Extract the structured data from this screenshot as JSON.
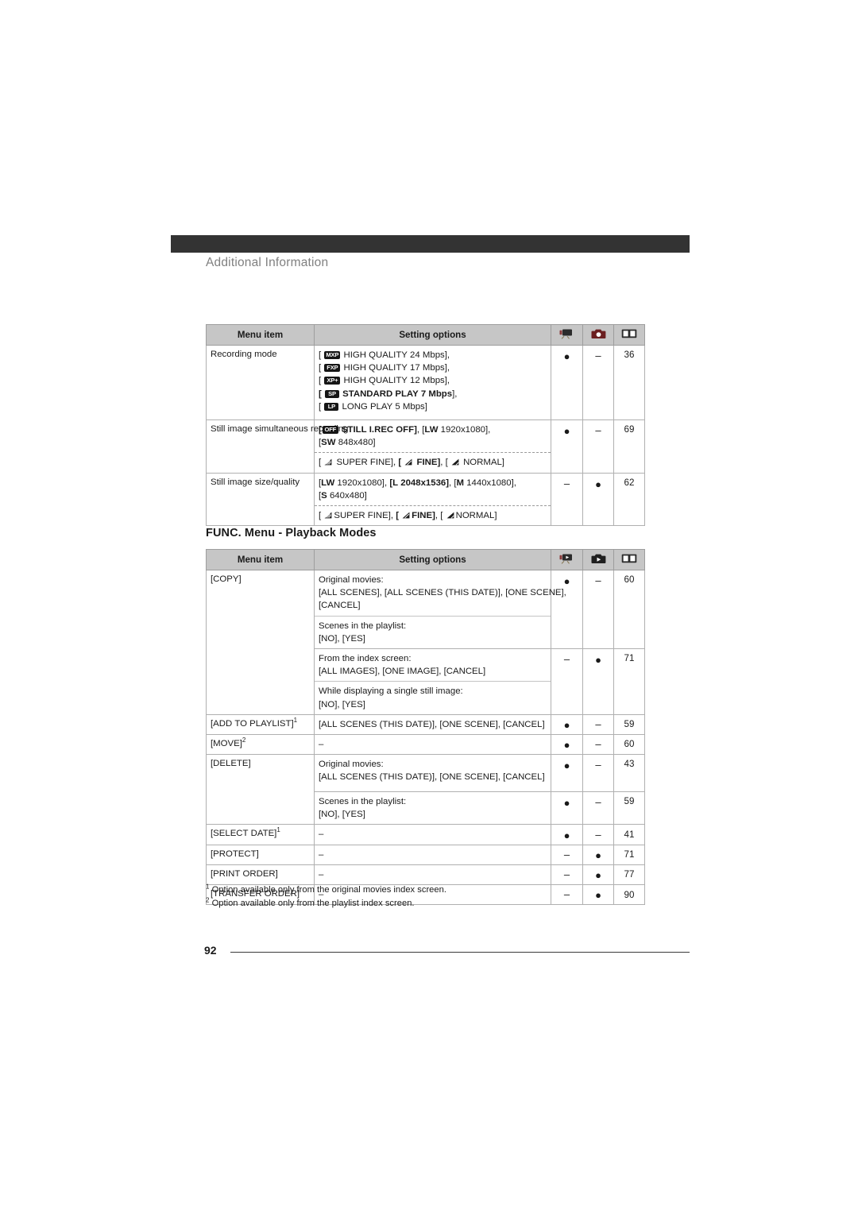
{
  "document": {
    "header_title": "Additional Information",
    "page_number": "92",
    "section_heading": "FUNC. Menu - Playback Modes"
  },
  "columns": {
    "menu_item": "Menu item",
    "setting_options": "Setting options",
    "icon_movie": "camcorder-icon",
    "icon_photo": "camera-icon",
    "icon_page": "open-book-icon",
    "icon_movie_playback": "camcorder-playback-icon",
    "icon_photo_playback": "camera-playback-icon"
  },
  "symbols": {
    "available": "●",
    "not_available": "–"
  },
  "table_recording": {
    "rows": [
      {
        "item": "Recording mode",
        "blocks": [
          {
            "lines": [
              {
                "parts": [
                  {
                    "t": "text",
                    "v": "[ "
                  },
                  {
                    "t": "badge",
                    "v": "MXP"
                  },
                  {
                    "t": "text",
                    "v": " HIGH QUALITY 24 Mbps],"
                  }
                ]
              },
              {
                "parts": [
                  {
                    "t": "text",
                    "v": "[ "
                  },
                  {
                    "t": "badge",
                    "v": "FXP"
                  },
                  {
                    "t": "text",
                    "v": " HIGH QUALITY 17 Mbps],"
                  }
                ]
              },
              {
                "parts": [
                  {
                    "t": "text",
                    "v": "[ "
                  },
                  {
                    "t": "badge",
                    "v": "XP+"
                  },
                  {
                    "t": "text",
                    "v": " HIGH QUALITY 12 Mbps],"
                  }
                ]
              },
              {
                "parts": [
                  {
                    "t": "textb",
                    "v": "[ "
                  },
                  {
                    "t": "badge",
                    "v": "SP"
                  },
                  {
                    "t": "textb",
                    "v": " STANDARD PLAY 7 Mbps"
                  },
                  {
                    "t": "text",
                    "v": "],"
                  }
                ]
              },
              {
                "parts": [
                  {
                    "t": "text",
                    "v": "[ "
                  },
                  {
                    "t": "badge",
                    "v": "LP"
                  },
                  {
                    "t": "text",
                    "v": " LONG PLAY 5 Mbps]"
                  }
                ]
              }
            ]
          }
        ],
        "movie": "●",
        "photo": "–",
        "page": "36"
      },
      {
        "item": "Still image simultaneous recording",
        "blocks": [
          {
            "lines": [
              {
                "parts": [
                  {
                    "t": "textb",
                    "v": "["
                  },
                  {
                    "t": "badge",
                    "v": "OFF"
                  },
                  {
                    "t": "textb",
                    "v": " STILL I.REC OFF]"
                  },
                  {
                    "t": "text",
                    "v": ", ["
                  },
                  {
                    "t": "textb",
                    "v": "LW"
                  },
                  {
                    "t": "text",
                    "v": " 1920x1080],"
                  }
                ]
              },
              {
                "parts": [
                  {
                    "t": "text",
                    "v": "["
                  },
                  {
                    "t": "textb",
                    "v": "SW"
                  },
                  {
                    "t": "text",
                    "v": " 848x480]"
                  }
                ]
              }
            ]
          },
          {
            "dashed": true,
            "lines": [
              {
                "parts": [
                  {
                    "t": "text",
                    "v": "[ "
                  },
                  {
                    "t": "qico",
                    "v": "superfine"
                  },
                  {
                    "t": "text",
                    "v": " SUPER FINE], "
                  },
                  {
                    "t": "textb",
                    "v": "[ "
                  },
                  {
                    "t": "qico",
                    "v": "fine"
                  },
                  {
                    "t": "textb",
                    "v": " FINE]"
                  },
                  {
                    "t": "text",
                    "v": ", [ "
                  },
                  {
                    "t": "qico",
                    "v": "normal"
                  },
                  {
                    "t": "text",
                    "v": " NORMAL]"
                  }
                ]
              }
            ]
          }
        ],
        "movie": "●",
        "photo": "–",
        "page": "69"
      },
      {
        "item": "Still image size/quality",
        "blocks": [
          {
            "lines": [
              {
                "parts": [
                  {
                    "t": "text",
                    "v": "["
                  },
                  {
                    "t": "textb",
                    "v": "LW"
                  },
                  {
                    "t": "text",
                    "v": " 1920x1080], "
                  },
                  {
                    "t": "textb",
                    "v": "[L 2048x1536]"
                  },
                  {
                    "t": "text",
                    "v": ", ["
                  },
                  {
                    "t": "textb",
                    "v": "M"
                  },
                  {
                    "t": "text",
                    "v": " 1440x1080],"
                  }
                ]
              },
              {
                "parts": [
                  {
                    "t": "text",
                    "v": "["
                  },
                  {
                    "t": "textb",
                    "v": "S"
                  },
                  {
                    "t": "text",
                    "v": " 640x480]"
                  }
                ]
              }
            ]
          },
          {
            "dashed": true,
            "lines": [
              {
                "parts": [
                  {
                    "t": "text",
                    "v": "[ "
                  },
                  {
                    "t": "qico",
                    "v": "superfine"
                  },
                  {
                    "t": "text",
                    "v": "SUPER FINE], "
                  },
                  {
                    "t": "textb",
                    "v": "[ "
                  },
                  {
                    "t": "qico",
                    "v": "fine"
                  },
                  {
                    "t": "textb",
                    "v": "FINE]"
                  },
                  {
                    "t": "text",
                    "v": ", [ "
                  },
                  {
                    "t": "qico",
                    "v": "normal"
                  },
                  {
                    "t": "text",
                    "v": "NORMAL]"
                  }
                ]
              }
            ]
          }
        ],
        "movie": "–",
        "photo": "●",
        "page": "62"
      }
    ]
  },
  "table_playback": {
    "rows": [
      {
        "item": "[COPY]",
        "blocks": [
          {
            "lines": [
              {
                "parts": [
                  {
                    "t": "text",
                    "v": "Original movies:"
                  }
                ]
              },
              {
                "parts": [
                  {
                    "t": "text",
                    "v": "[ALL SCENES], [ALL SCENES (THIS DATE)], [ONE SCENE],"
                  }
                ]
              },
              {
                "parts": [
                  {
                    "t": "text",
                    "v": "[CANCEL]"
                  }
                ]
              }
            ]
          },
          {
            "solid": true,
            "lines": [
              {
                "parts": [
                  {
                    "t": "text",
                    "v": "Scenes in the playlist:"
                  }
                ]
              },
              {
                "parts": [
                  {
                    "t": "text",
                    "v": "[NO], [YES]"
                  }
                ]
              }
            ]
          }
        ],
        "movie": "●",
        "photo": "–",
        "page": "60"
      },
      {
        "item": "",
        "blocks": [
          {
            "lines": [
              {
                "parts": [
                  {
                    "t": "text",
                    "v": "From the index screen:"
                  }
                ]
              },
              {
                "parts": [
                  {
                    "t": "text",
                    "v": "[ALL IMAGES], [ONE IMAGE], [CANCEL]"
                  }
                ]
              }
            ]
          },
          {
            "solid": true,
            "lines": [
              {
                "parts": [
                  {
                    "t": "text",
                    "v": "While displaying a single still image:"
                  }
                ]
              },
              {
                "parts": [
                  {
                    "t": "text",
                    "v": "[NO], [YES]"
                  }
                ]
              }
            ]
          }
        ],
        "movie": "–",
        "photo": "●",
        "page": "71"
      },
      {
        "item": "[ADD TO PLAYLIST]",
        "item_sup": "1",
        "blocks": [
          {
            "lines": [
              {
                "parts": [
                  {
                    "t": "text",
                    "v": "[ALL SCENES (THIS DATE)], [ONE SCENE], [CANCEL]"
                  }
                ]
              }
            ]
          }
        ],
        "movie": "●",
        "photo": "–",
        "page": "59"
      },
      {
        "item": "[MOVE]",
        "item_sup": "2",
        "blocks": [
          {
            "lines": [
              {
                "parts": [
                  {
                    "t": "text",
                    "v": "–"
                  }
                ]
              }
            ]
          }
        ],
        "movie": "●",
        "photo": "–",
        "page": "60"
      },
      {
        "item": "[DELETE]",
        "blocks": [
          {
            "lines": [
              {
                "parts": [
                  {
                    "t": "text",
                    "v": "Original movies:"
                  }
                ]
              },
              {
                "parts": [
                  {
                    "t": "text",
                    "v": "[ALL SCENES (THIS DATE)], [ONE SCENE], [CANCEL]"
                  }
                ]
              }
            ]
          }
        ],
        "movie": "●",
        "photo": "–",
        "page": "43"
      },
      {
        "item": "",
        "blocks": [
          {
            "lines": [
              {
                "parts": [
                  {
                    "t": "text",
                    "v": "Scenes in the playlist:"
                  }
                ]
              },
              {
                "parts": [
                  {
                    "t": "text",
                    "v": "[NO], [YES]"
                  }
                ]
              }
            ]
          }
        ],
        "movie": "●",
        "photo": "–",
        "page": "59"
      },
      {
        "item": "[SELECT DATE]",
        "item_sup": "1",
        "blocks": [
          {
            "lines": [
              {
                "parts": [
                  {
                    "t": "text",
                    "v": "–"
                  }
                ]
              }
            ]
          }
        ],
        "movie": "●",
        "photo": "–",
        "page": "41"
      },
      {
        "item": "[PROTECT]",
        "blocks": [
          {
            "lines": [
              {
                "parts": [
                  {
                    "t": "text",
                    "v": "–"
                  }
                ]
              }
            ]
          }
        ],
        "movie": "–",
        "photo": "●",
        "page": "71"
      },
      {
        "item": "[PRINT ORDER]",
        "blocks": [
          {
            "lines": [
              {
                "parts": [
                  {
                    "t": "text",
                    "v": "–"
                  }
                ]
              }
            ]
          }
        ],
        "movie": "–",
        "photo": "●",
        "page": "77"
      },
      {
        "item": "[TRANSFER ORDER]",
        "blocks": [
          {
            "lines": [
              {
                "parts": [
                  {
                    "t": "text",
                    "v": "–"
                  }
                ]
              }
            ]
          }
        ],
        "movie": "–",
        "photo": "●",
        "page": "90"
      }
    ]
  },
  "footnotes": [
    {
      "num": "1",
      "text": "Option available only from the original movies index screen."
    },
    {
      "num": "2",
      "text": "Option available only from the playlist index screen."
    }
  ]
}
